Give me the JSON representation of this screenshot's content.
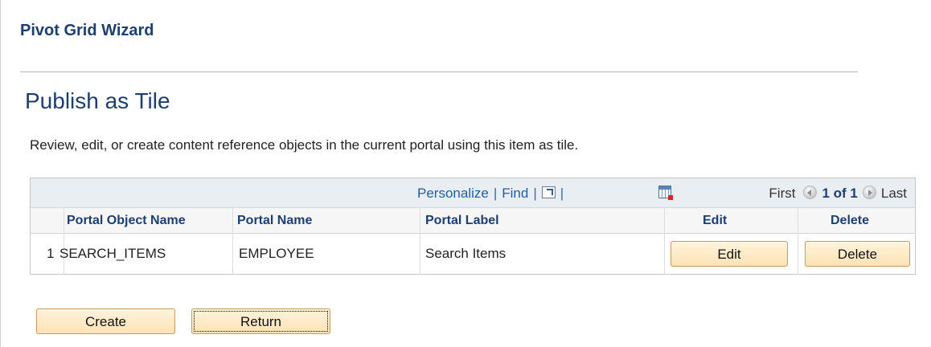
{
  "header": {
    "wizard_title": "Pivot Grid Wizard",
    "page_title": "Publish as Tile",
    "instructions": "Review, edit, or create content reference objects in the current portal using this item as tile."
  },
  "grid": {
    "toolbar": {
      "personalize": "Personalize",
      "find": "Find",
      "separator": "|",
      "zoom_icon": "view-all-icon",
      "download_icon": "download-to-excel-icon"
    },
    "pager": {
      "first": "First",
      "count": "1 of 1",
      "last": "Last"
    },
    "columns": [
      "Portal Object Name",
      "Portal Name",
      "Portal Label",
      "Edit",
      "Delete"
    ],
    "rows": [
      {
        "num": "1",
        "object_name": "SEARCH_ITEMS",
        "portal_name": "EMPLOYEE",
        "portal_label": "Search Items",
        "edit_label": "Edit",
        "delete_label": "Delete"
      }
    ]
  },
  "actions": {
    "create_label": "Create",
    "return_label": "Return"
  },
  "colors": {
    "title": "#1c3f73",
    "link": "#1f5fa8",
    "button_bg": "#fde2b4",
    "button_border": "#c79b5a",
    "grid_header_bg": "#e9eef3"
  }
}
